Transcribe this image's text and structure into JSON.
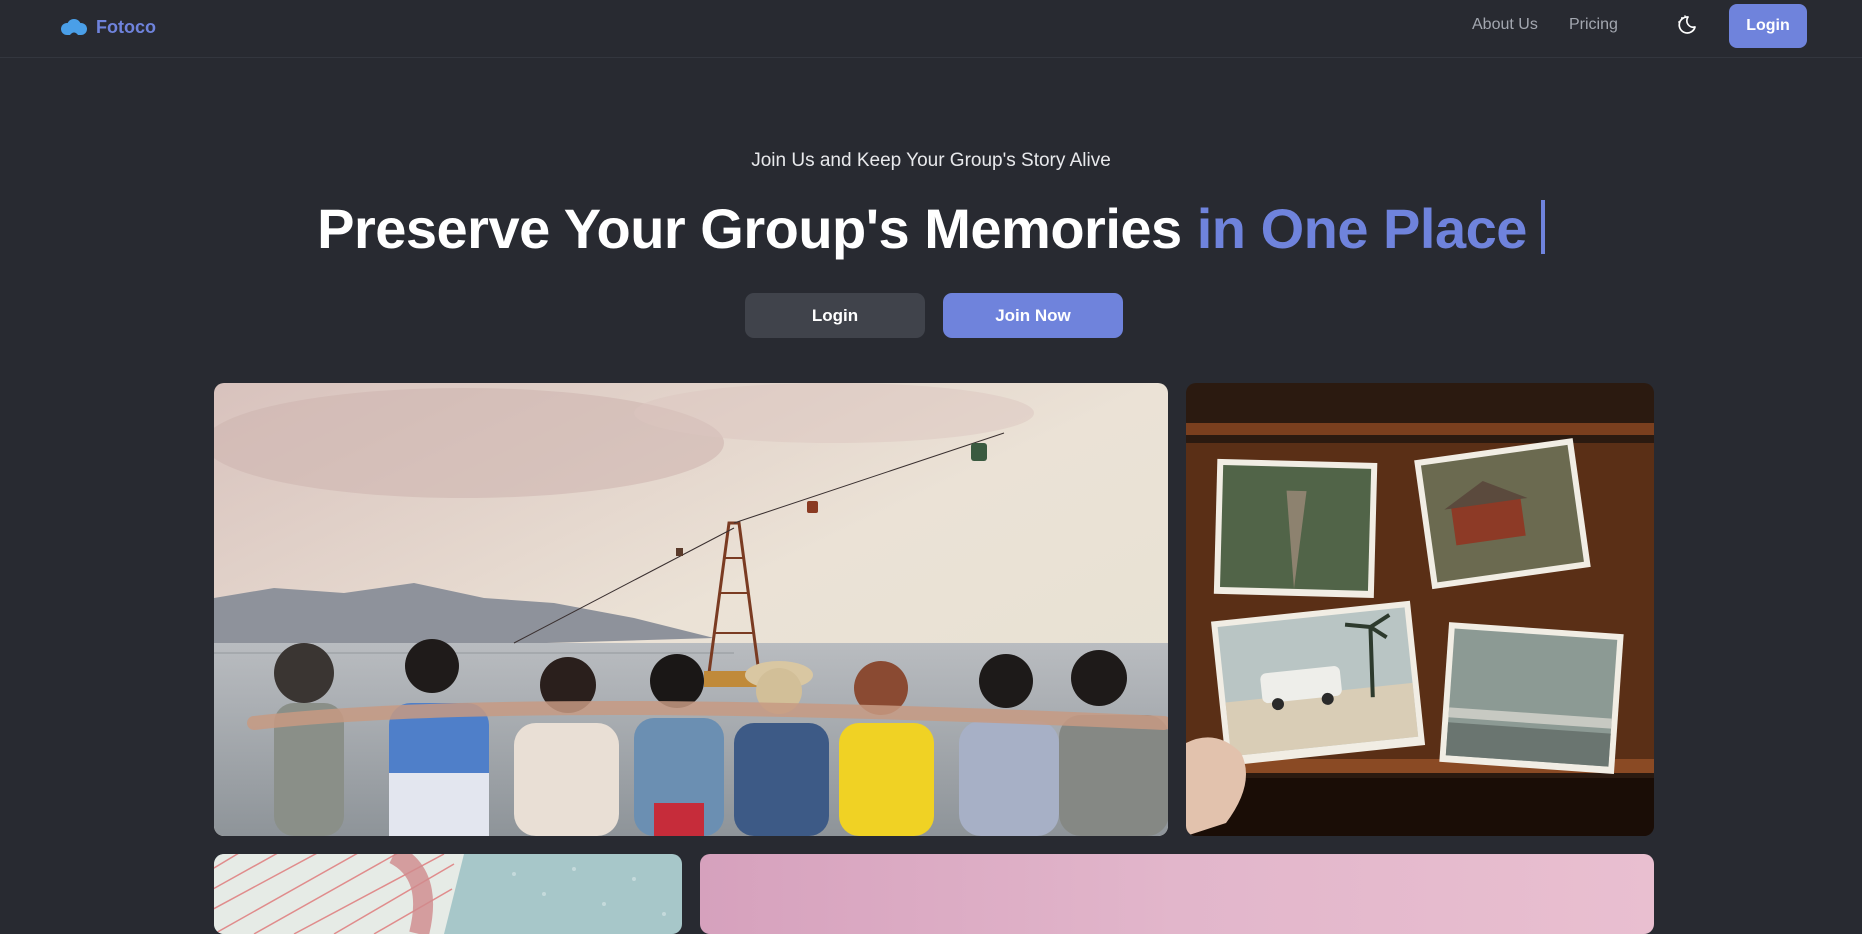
{
  "nav": {
    "brand": "Fotoco",
    "brand_icon": "cloud-icon",
    "links": [
      {
        "label": "About Us"
      },
      {
        "label": "Pricing"
      }
    ],
    "theme_toggle_icon": "moon-icon",
    "login_label": "Login"
  },
  "hero": {
    "subtitle": "Join Us and Keep Your Group's Story Alive",
    "title_main": "Preserve Your Group's Memories",
    "title_accent": "in One Place",
    "login_label": "Login",
    "join_label": "Join Now"
  },
  "colors": {
    "background": "#282a31",
    "accent": "#6f83dc",
    "secondary_button": "#40434b"
  },
  "gallery": [
    {
      "subject": "friends-by-the-sea-photo"
    },
    {
      "subject": "printed-photos-on-wood-photo"
    },
    {
      "subject": "notebook-photo"
    },
    {
      "subject": "pink-sky-photo"
    }
  ]
}
